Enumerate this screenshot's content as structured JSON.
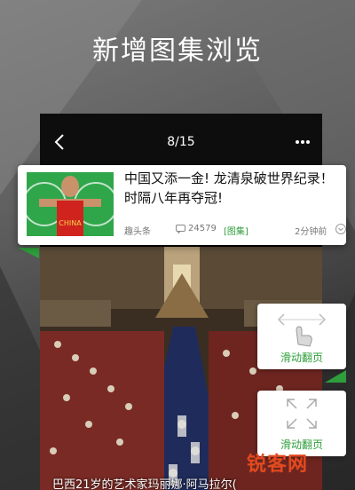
{
  "promo": {
    "title": "新增图集浏览"
  },
  "topbar": {
    "counter": "8/15",
    "back_icon": "back-chevron-icon",
    "more_icon": "more-dots-icon"
  },
  "news_card": {
    "title": "中国又添一金! 龙清泉破世界纪录！时隔八年再夺冠!",
    "source": "趣头条",
    "comment_count": "24579",
    "tag": "[图集]",
    "time": "2分钟前",
    "thumb_jersey_text": "CHINA"
  },
  "photo": {
    "caption": "巴西21岁的艺术家玛丽娜·阿马拉尔("
  },
  "hints": [
    {
      "label": "滑动翻页",
      "icon": "hand-swipe-icon"
    },
    {
      "label": "滑动翻页",
      "icon": "expand-arrows-icon"
    }
  ],
  "watermark": {
    "text": "锐客网"
  },
  "colors": {
    "accent_green": "#2e9e3a",
    "background": "#4a4a4a",
    "watermark": "#e24a1f"
  }
}
